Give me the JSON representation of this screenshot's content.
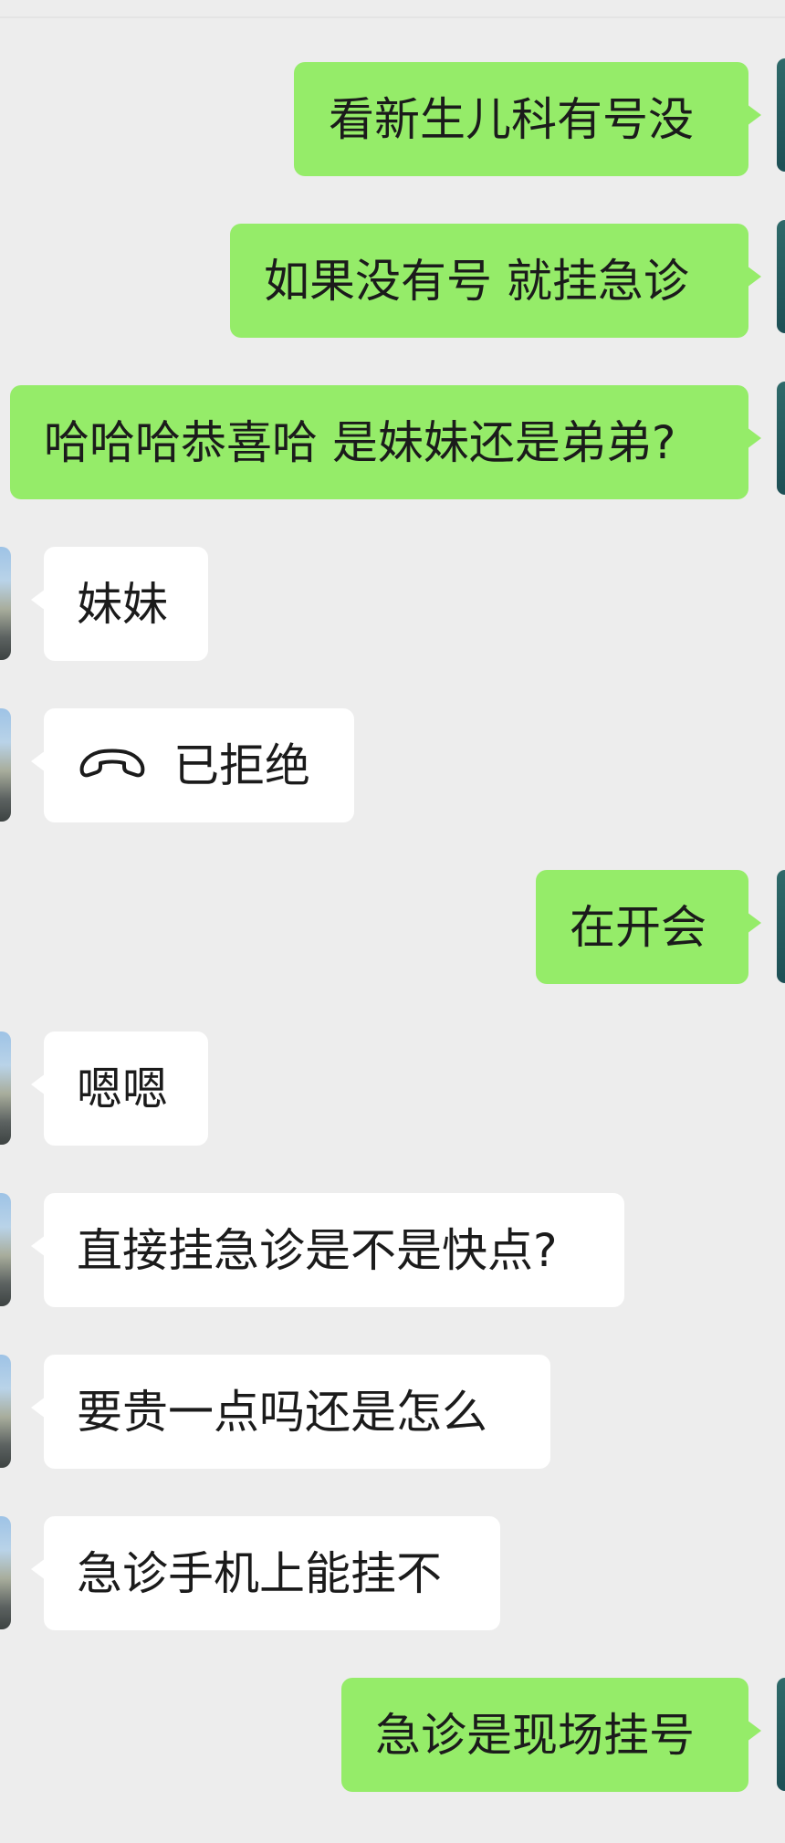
{
  "messages": [
    {
      "side": "sent",
      "text": "看新生儿科有号没"
    },
    {
      "side": "sent",
      "text": "如果没有号 就挂急诊"
    },
    {
      "side": "sent",
      "text": "哈哈哈恭喜哈 是妹妹还是弟弟?"
    },
    {
      "side": "recv",
      "text": "妹妹"
    },
    {
      "side": "recv",
      "text": "已拒绝",
      "icon": "declined-call-icon"
    },
    {
      "side": "sent",
      "text": "在开会"
    },
    {
      "side": "recv",
      "text": "嗯嗯"
    },
    {
      "side": "recv",
      "text": "直接挂急诊是不是快点?"
    },
    {
      "side": "recv",
      "text": "要贵一点吗还是怎么"
    },
    {
      "side": "recv",
      "text": "急诊手机上能挂不"
    },
    {
      "side": "sent",
      "text": "急诊是现场挂号"
    }
  ],
  "colors": {
    "background": "#ededed",
    "sent_bubble": "#95ec69",
    "received_bubble": "#ffffff",
    "text": "#1b1b1b"
  }
}
